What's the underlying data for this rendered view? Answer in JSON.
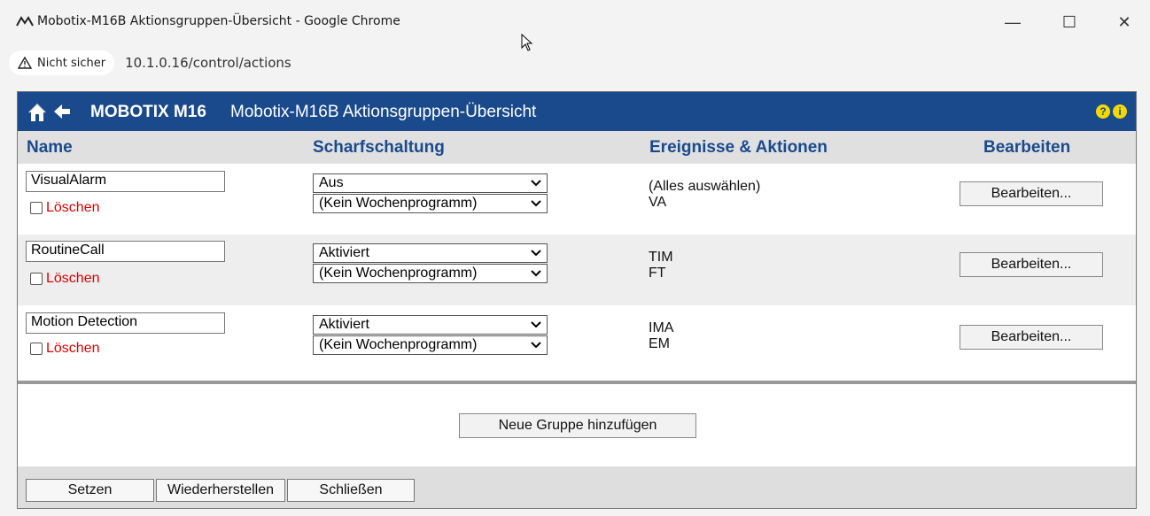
{
  "window": {
    "title": "Mobotix-M16B Aktionsgruppen-Übersicht - Google Chrome",
    "minimize": "—",
    "maximize": "☐",
    "close": "✕"
  },
  "address": {
    "security_label": "Nicht sicher",
    "url": "10.1.0.16/control/actions"
  },
  "header": {
    "brand": "MOBOTIX M16",
    "title": "Mobotix-M16B Aktionsgruppen-Übersicht",
    "help": "?",
    "info": "i"
  },
  "columns": {
    "name": "Name",
    "arming": "Scharfschaltung",
    "events": "Ereignisse & Aktionen",
    "edit": "Bearbeiten"
  },
  "rows": [
    {
      "name": "VisualAlarm",
      "delete_label": "Löschen",
      "arming": "Aus",
      "schedule": "(Kein Wochenprogramm)",
      "events": [
        "(Alles auswählen)",
        "VA"
      ],
      "edit_label": "Bearbeiten..."
    },
    {
      "name": "RoutineCall",
      "delete_label": "Löschen",
      "arming": "Aktiviert",
      "schedule": "(Kein Wochenprogramm)",
      "events": [
        "TIM",
        "FT"
      ],
      "edit_label": "Bearbeiten..."
    },
    {
      "name": "Motion Detection",
      "delete_label": "Löschen",
      "arming": "Aktiviert",
      "schedule": "(Kein Wochenprogramm)",
      "events": [
        "IMA",
        "EM"
      ],
      "edit_label": "Bearbeiten..."
    }
  ],
  "add_group_label": "Neue Gruppe hinzufügen",
  "footer": {
    "set": "Setzen",
    "restore": "Wiederherstellen",
    "close": "Schließen"
  },
  "colors": {
    "header_bg": "#1a4a8c",
    "column_heading": "#1a4a8c",
    "delete_red": "#e00000",
    "icon_yellow": "#f5d800"
  }
}
